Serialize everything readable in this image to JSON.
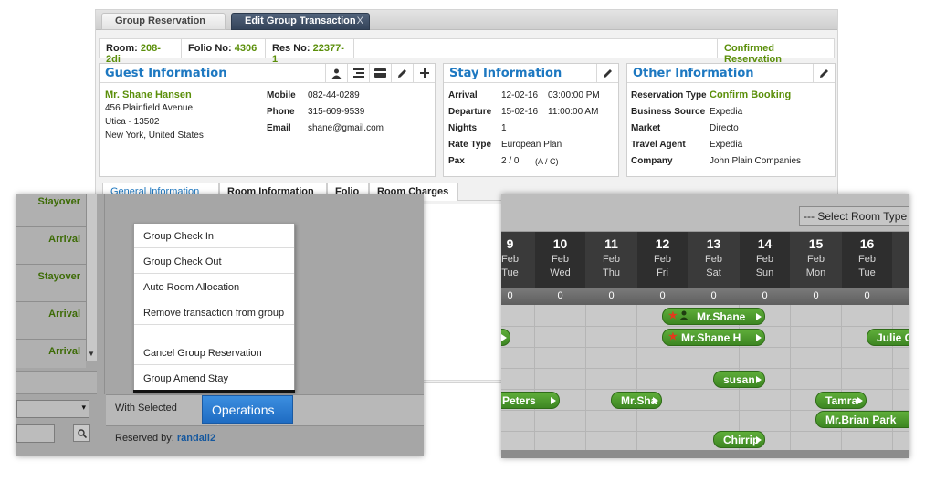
{
  "tabs": [
    {
      "label": "Group Reservation"
    },
    {
      "label": "Edit Group Transaction"
    }
  ],
  "tab_close": "X",
  "infobar": {
    "room_label": "Room:",
    "room_value": "208-2di",
    "folio_label": "Folio No:",
    "folio_value": "4306",
    "res_label": "Res No:",
    "res_value": "22377-1",
    "status": "Confirmed Reservation"
  },
  "guest": {
    "title": "Guest Information",
    "name": "Mr. Shane Hansen",
    "address1": "456 Plainfield Avenue,",
    "address2": "Utica - 13502",
    "address3": "New York, United States",
    "mobile_label": "Mobile",
    "mobile": "082-44-0289",
    "phone_label": "Phone",
    "phone": "315-609-9539",
    "email_label": "Email",
    "email": "shane@gmail.com"
  },
  "stay": {
    "title": "Stay Information",
    "arrival_label": "Arrival",
    "arrival_date": "12-02-16",
    "arrival_time": "03:00:00 PM",
    "departure_label": "Departure",
    "departure_date": "15-02-16",
    "departure_time": "11:00:00 AM",
    "nights_label": "Nights",
    "nights": "1",
    "rate_label": "Rate Type",
    "rate": "European Plan",
    "pax_label": "Pax",
    "pax": "2 / 0",
    "pax_unit": "(A / C)"
  },
  "other": {
    "title": "Other Information",
    "restype_label": "Reservation Type",
    "restype": "Confirm Booking",
    "source_label": "Business Source",
    "source": "Expedia",
    "market_label": "Market",
    "market": "Directo",
    "agent_label": "Travel Agent",
    "agent": "Expedia",
    "company_label": "Company",
    "company": "John Plain Companies"
  },
  "subtabs": [
    {
      "label": "General Information"
    },
    {
      "label": "Room Information"
    },
    {
      "label": "Folio"
    },
    {
      "label": "Room Charges"
    }
  ],
  "left_overlay": {
    "statuses": [
      "Stayover",
      "Arrival",
      "Stayover",
      "Arrival",
      "Arrival"
    ],
    "menu": [
      "Group Check In",
      "Group Check Out",
      "Auto Room Allocation",
      "Remove transaction from group",
      "Cancel Group Reservation",
      "Group Amend Stay"
    ],
    "with_selected": "With Selected",
    "operations": "Operations",
    "reserved_by_label": "Reserved by:",
    "reserved_by": "randall2"
  },
  "right_overlay": {
    "select_placeholder": "--- Select Room Type",
    "dates": [
      {
        "d": "9",
        "m": "Feb",
        "w": "Tue"
      },
      {
        "d": "10",
        "m": "Feb",
        "w": "Wed"
      },
      {
        "d": "11",
        "m": "Feb",
        "w": "Thu"
      },
      {
        "d": "12",
        "m": "Feb",
        "w": "Fri"
      },
      {
        "d": "13",
        "m": "Feb",
        "w": "Sat"
      },
      {
        "d": "14",
        "m": "Feb",
        "w": "Sun"
      },
      {
        "d": "15",
        "m": "Feb",
        "w": "Mon"
      },
      {
        "d": "16",
        "m": "Feb",
        "w": "Tue"
      }
    ],
    "zero": "0",
    "bookings": [
      "Mr.Shane",
      "Mr.Shane H",
      "Julie G",
      "susan",
      "Peters",
      "Mr.Sha",
      "Tamra",
      "Mr.Brian Park",
      "Chirrip"
    ]
  },
  "colors": {
    "accent": "#1d78c1",
    "green": "#5b8f0a",
    "dark_header": "#3a3a3a"
  }
}
